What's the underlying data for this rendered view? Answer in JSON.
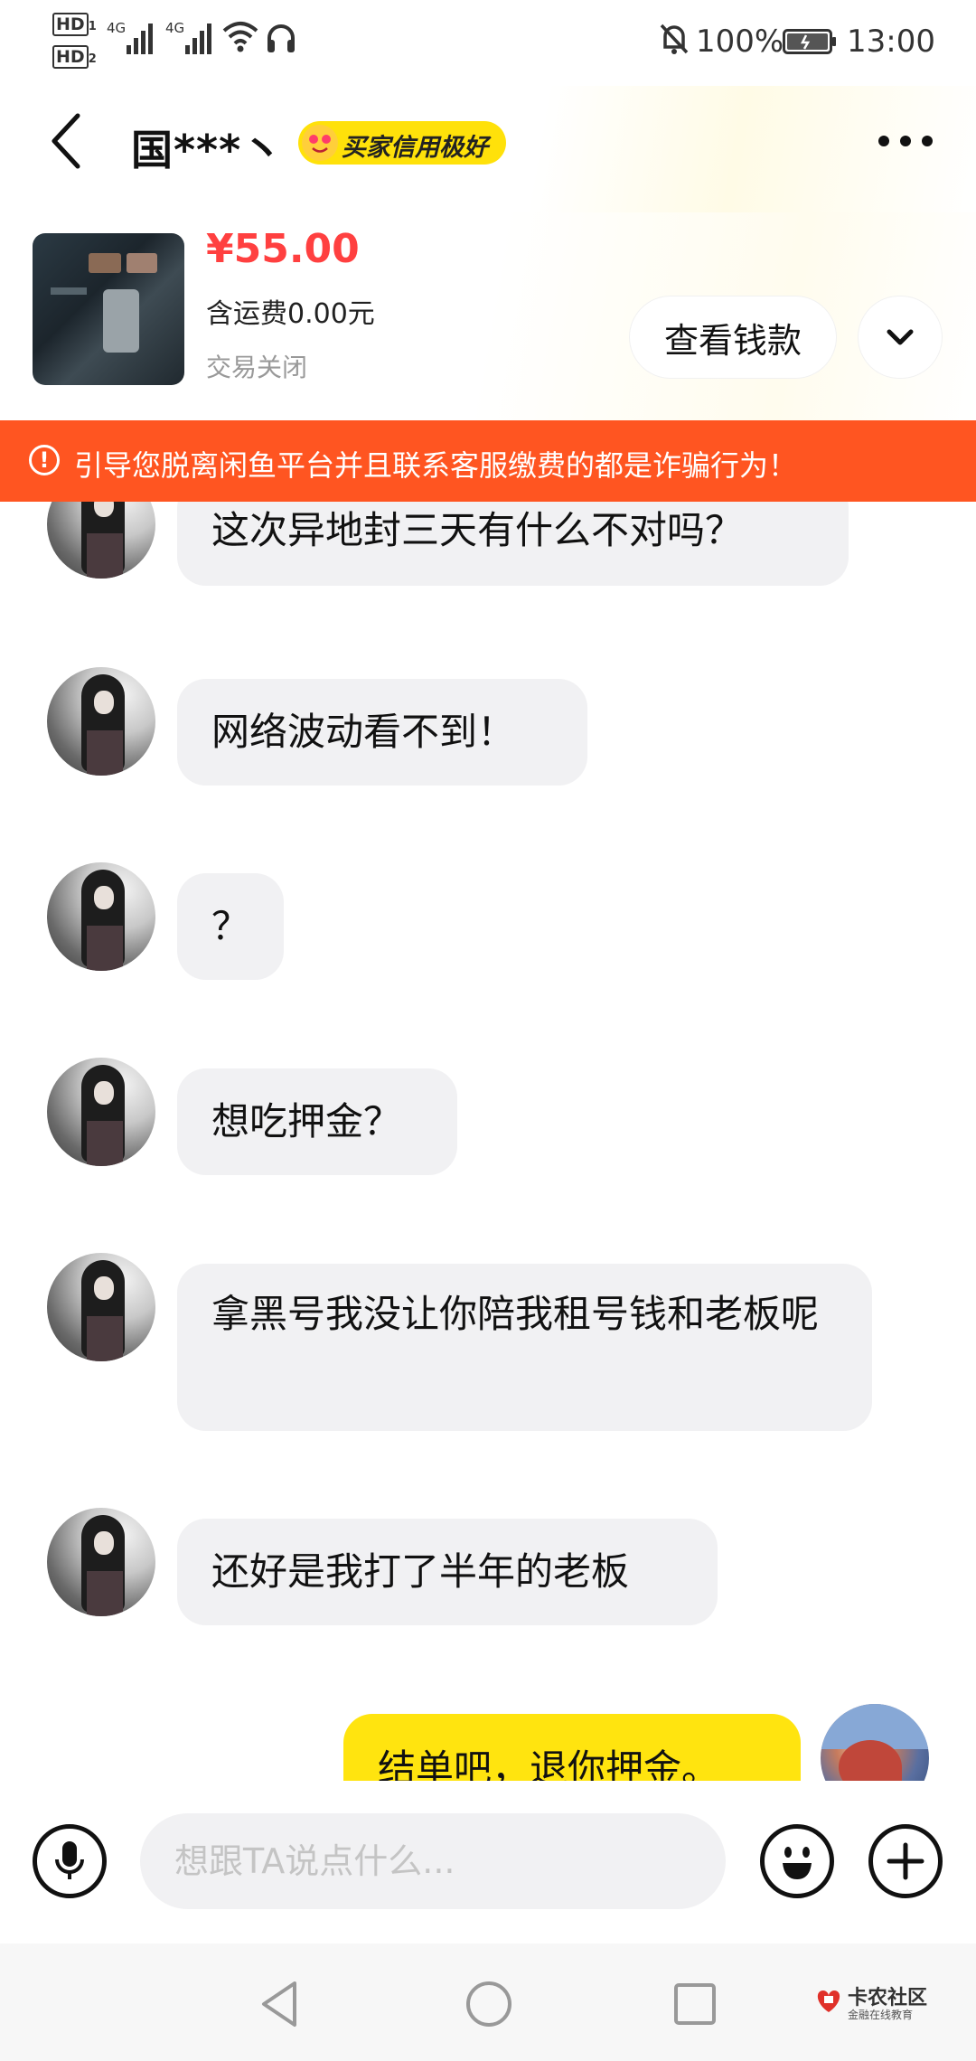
{
  "status_bar": {
    "hd1": "HD",
    "hd1_num": "1",
    "hd2": "HD",
    "hd2_num": "2",
    "net1": "4G",
    "net2": "4G",
    "battery": "100%",
    "time": "13:00"
  },
  "header": {
    "title": "国***丶",
    "badge": "买家信用极好"
  },
  "product": {
    "price": "¥55.00",
    "shipping": "含运费0.00元",
    "status": "交易关闭",
    "view_button": "查看钱款"
  },
  "warning": {
    "icon": "!",
    "text": "引导您脱离闲鱼平台并且联系客服缴费的都是诈骗行为！"
  },
  "messages": [
    {
      "text": "这次异地封三天有什么不对吗？"
    },
    {
      "text": "网络波动看不到！"
    },
    {
      "text": "？"
    },
    {
      "text": "想吃押金？"
    },
    {
      "text": "拿黑号我没让你陪我租号钱和老板呢"
    },
    {
      "text": "还好是我打了半年的老板"
    },
    {
      "text": "结单吧，退你押金。"
    }
  ],
  "input": {
    "placeholder": "想跟TA说点什么..."
  },
  "watermark": {
    "title": "卡农社区",
    "subtitle": "金融在线教育"
  },
  "colors": {
    "price": "#ff4040",
    "warning_bg": "#ff5521",
    "badge_bg": "#ffe10a",
    "my_bubble": "#ffe40f",
    "their_bubble": "#f1f1f3"
  }
}
